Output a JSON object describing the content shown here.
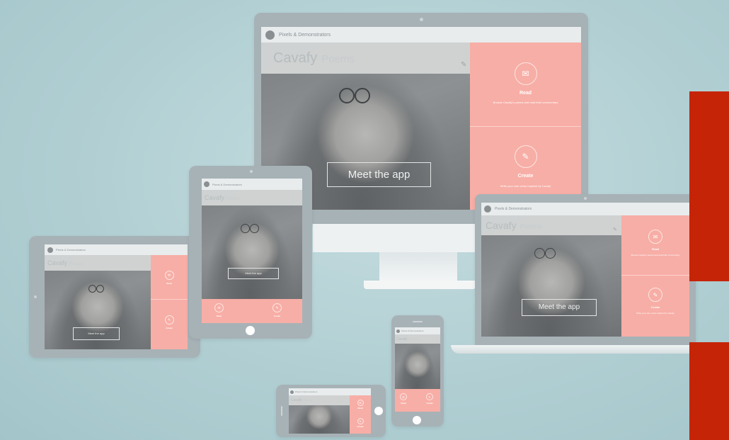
{
  "app": {
    "brand": "Pixels & Demonstrators",
    "title": "Cavafy",
    "subtitle": "Poems",
    "cta": "Meet the app",
    "read_label": "Read",
    "read_desc": "Browse Cavafy's poems and read their commentary",
    "create_label": "Create",
    "create_desc": "Write your own verse inspired by Cavafy"
  },
  "colors": {
    "background": "#b1cfd3",
    "accent": "#f7aea6",
    "device": "#a7b2b6",
    "alert": "#c62407"
  },
  "icons": {
    "read": "envelope-icon",
    "create": "pencil-icon",
    "edit": "pencil-icon"
  }
}
